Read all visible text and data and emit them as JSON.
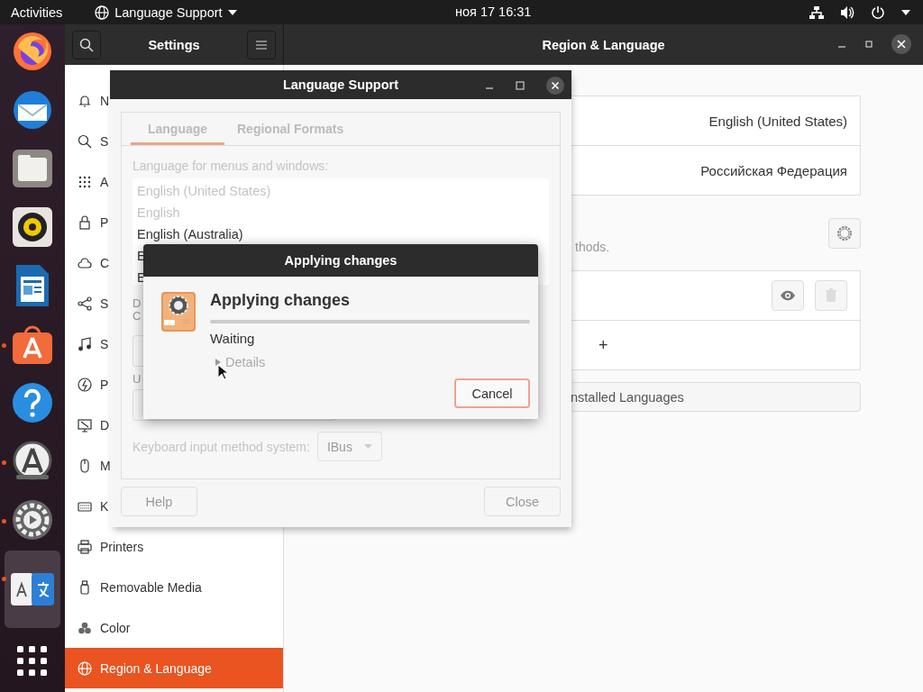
{
  "top_bar": {
    "activities": "Activities",
    "app_menu": "Language Support",
    "clock": "ноя 17 16:31"
  },
  "dock": [
    {
      "kind": "firefox",
      "running": false,
      "selected": false
    },
    {
      "kind": "mail",
      "running": false,
      "selected": false
    },
    {
      "kind": "files",
      "running": false,
      "selected": false
    },
    {
      "kind": "music",
      "running": false,
      "selected": false
    },
    {
      "kind": "writer",
      "running": false,
      "selected": false
    },
    {
      "kind": "store",
      "running": true,
      "selected": false
    },
    {
      "kind": "help",
      "running": false,
      "selected": false
    },
    {
      "kind": "updater",
      "running": true,
      "selected": false
    },
    {
      "kind": "settings",
      "running": true,
      "selected": false
    },
    {
      "kind": "language",
      "running": true,
      "selected": true
    },
    {
      "kind": "apps",
      "running": false,
      "selected": false
    }
  ],
  "settings_window": {
    "title": "Settings",
    "page_title": "Region & Language",
    "sidebar": [
      {
        "kind": "bell",
        "label": "N",
        "selected": false
      },
      {
        "kind": "search",
        "label": "S",
        "selected": false
      },
      {
        "kind": "grid",
        "label": "A",
        "selected": false
      },
      {
        "kind": "lock",
        "label": "P",
        "selected": false
      },
      {
        "kind": "cloud",
        "label": "C",
        "selected": false
      },
      {
        "kind": "share",
        "label": "S",
        "selected": false
      },
      {
        "kind": "music",
        "label": "S",
        "selected": false
      },
      {
        "kind": "power",
        "label": "P",
        "selected": false
      },
      {
        "kind": "display",
        "label": "D",
        "selected": false
      },
      {
        "kind": "mouse",
        "label": "M",
        "selected": false
      },
      {
        "kind": "keyboard",
        "label": "K",
        "selected": false
      },
      {
        "kind": "printer",
        "label": "Printers",
        "selected": false
      },
      {
        "kind": "usb",
        "label": "Removable Media",
        "selected": false
      },
      {
        "kind": "color",
        "label": "Color",
        "selected": false
      },
      {
        "kind": "globe",
        "label": "Region & Language",
        "selected": true
      }
    ],
    "rows": [
      {
        "value": "English (United States)"
      },
      {
        "value": "Российская Федерация"
      }
    ],
    "hint": "thods.",
    "add_label": "+",
    "manage_button": "nstalled Languages"
  },
  "language_support": {
    "title": "Language Support",
    "disabled": true,
    "tabs": [
      {
        "label": "Language",
        "selected": true
      },
      {
        "label": "Regional Formats",
        "selected": false
      }
    ],
    "list_label": "Language for menus and windows:",
    "languages": [
      {
        "name": "English (United States)",
        "disabled": true
      },
      {
        "name": "English",
        "disabled": true
      },
      {
        "name": "English (Australia)",
        "disabled": false
      },
      {
        "name": "E",
        "disabled": false
      },
      {
        "name": "E",
        "disabled": false
      }
    ],
    "partial_labels": [
      "D",
      "C"
    ],
    "partial_label_2": "U",
    "keyboard_label": "Keyboard input method system:",
    "input_method": "IBus",
    "help": "Help",
    "close": "Close"
  },
  "dialog": {
    "title": "Applying changes",
    "heading": "Applying changes",
    "level": 0,
    "status": "Waiting",
    "details": {
      "label": "Details",
      "expanded": false
    },
    "cancel": "Cancel"
  }
}
